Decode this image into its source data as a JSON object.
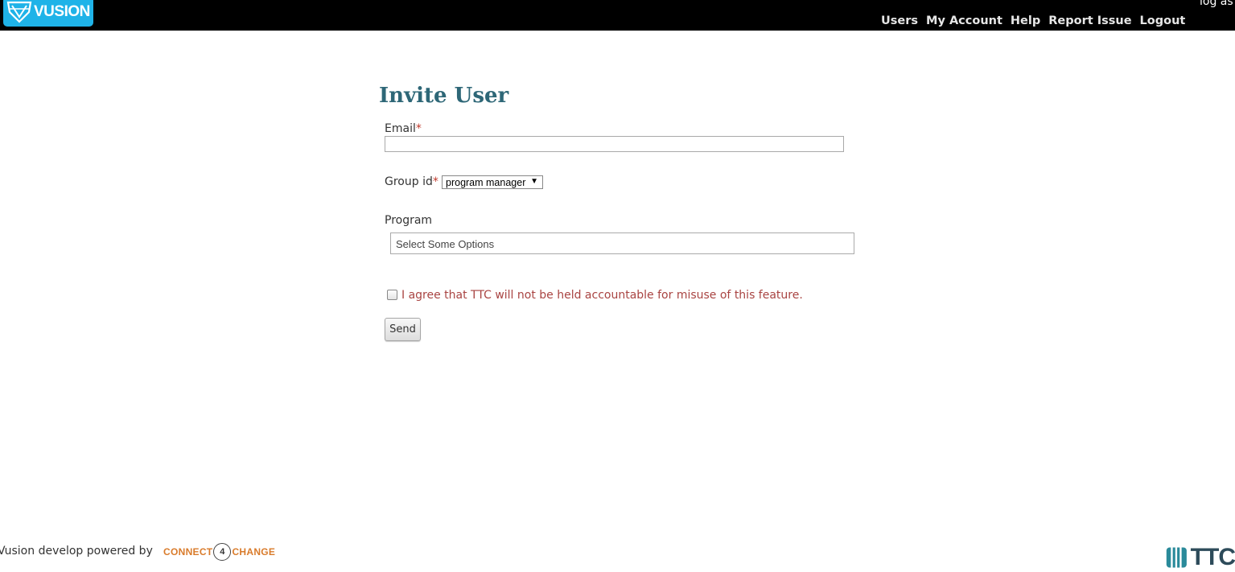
{
  "header": {
    "logo_text": "VUSION",
    "logged_as": "log as",
    "nav": [
      "Users",
      "My Account",
      "Help",
      "Report Issue",
      "Logout"
    ]
  },
  "form": {
    "title": "Invite User",
    "email_label": "Email",
    "email_value": "",
    "required_mark": "*",
    "group_label": "Group id",
    "group_selected": "program manager",
    "program_label": "Program",
    "program_placeholder": "Select Some Options",
    "agree_checked": false,
    "agree_text": "I agree that TTC will not be held accountable for misuse of this feature.",
    "send_label": "Send"
  },
  "footer": {
    "powered_text": "Vusion develop powered by",
    "c4c_left": "CONNECT",
    "c4c_mid": "4",
    "c4c_right": "CHANGE",
    "ttc_text": "TTC"
  },
  "colors": {
    "topbar": "#000000",
    "logo_bg": "#1fb3e8",
    "title": "#2e6777",
    "required": "#c0392b",
    "agree_text": "#a94442",
    "c4c_orange": "#d97b2b"
  },
  "icons": {
    "logo_icon": "vusion-shield-icon",
    "select_arrow": "dropdown-arrow-icon",
    "ttc_icon": "ttc-stripes-icon"
  }
}
